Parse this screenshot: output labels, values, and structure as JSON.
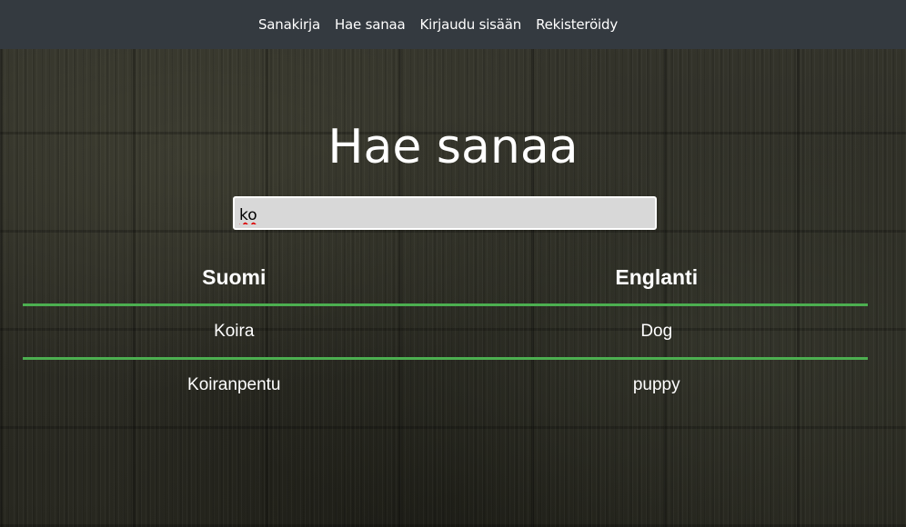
{
  "nav": {
    "items": [
      {
        "label": "Sanakirja"
      },
      {
        "label": "Hae sanaa"
      },
      {
        "label": "Kirjaudu sisään"
      },
      {
        "label": "Rekisteröidy"
      }
    ],
    "background": "#343a40"
  },
  "page": {
    "title": "Hae sanaa"
  },
  "search": {
    "value": "ko"
  },
  "table": {
    "headers": [
      "Suomi",
      "Englanti"
    ],
    "rows": [
      {
        "suomi": "Koira",
        "englanti": "Dog"
      },
      {
        "suomi": "Koiranpentu",
        "englanti": "puppy"
      }
    ],
    "divider_color": "#4caf50"
  }
}
